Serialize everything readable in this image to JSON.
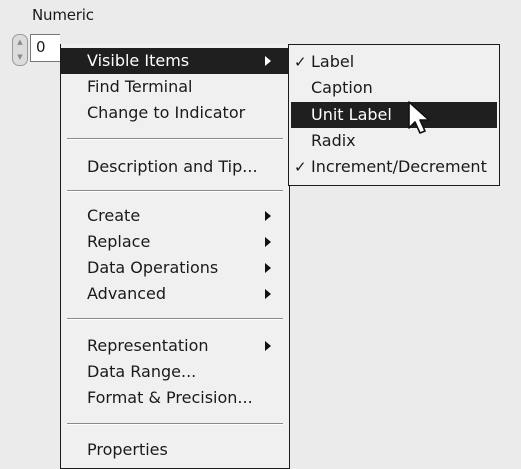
{
  "control": {
    "label": "Numeric",
    "value": "0",
    "increment_icon": "spinner-up-icon",
    "decrement_icon": "spinner-down-icon"
  },
  "context_menu": {
    "items": [
      {
        "label": "Visible Items",
        "submenu": true,
        "highlighted": true
      },
      {
        "label": "Find Terminal"
      },
      {
        "label": "Change to Indicator"
      },
      {
        "label": "Description and Tip..."
      },
      {
        "label": "Create",
        "submenu": true
      },
      {
        "label": "Replace",
        "submenu": true
      },
      {
        "label": "Data Operations",
        "submenu": true
      },
      {
        "label": "Advanced",
        "submenu": true
      },
      {
        "label": "Representation",
        "submenu": true
      },
      {
        "label": "Data Range..."
      },
      {
        "label": "Format & Precision..."
      },
      {
        "label": "Properties"
      }
    ]
  },
  "visible_items_submenu": {
    "check_mark": "✓",
    "items": [
      {
        "label": "Label",
        "checked": true
      },
      {
        "label": "Caption",
        "checked": false
      },
      {
        "label": "Unit Label",
        "checked": false,
        "highlighted": true
      },
      {
        "label": "Radix",
        "checked": false
      },
      {
        "label": "Increment/Decrement",
        "checked": true
      }
    ]
  },
  "colors": {
    "menu_background": "#f0f0f0",
    "highlight": "#1f1f1f",
    "highlight_text": "#ffffff"
  },
  "cursor": {
    "icon": "pointer-arrow-icon"
  }
}
